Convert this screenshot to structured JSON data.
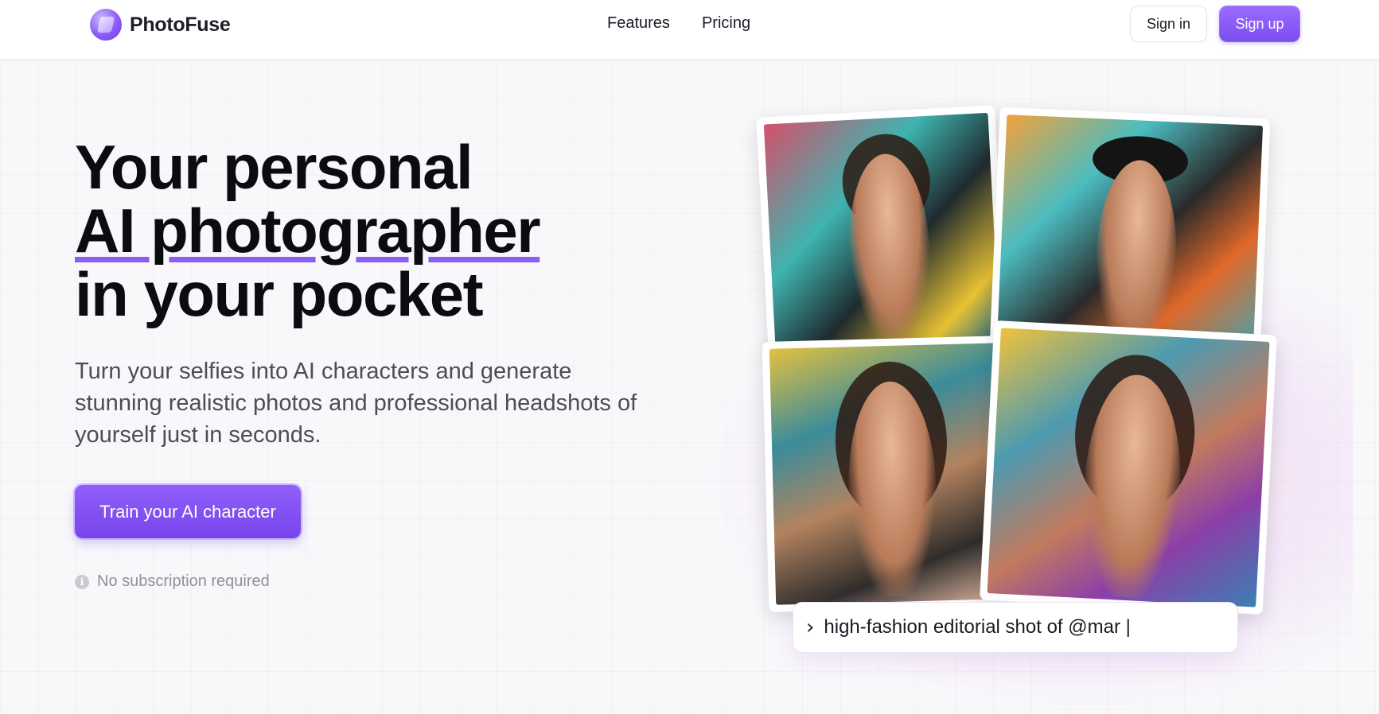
{
  "brand": {
    "name": "PhotoFuse",
    "icon": "photofuse-logo-icon"
  },
  "nav": {
    "items": [
      {
        "label": "Features"
      },
      {
        "label": "Pricing"
      }
    ]
  },
  "auth": {
    "signin_label": "Sign in",
    "signup_label": "Sign up"
  },
  "hero": {
    "headline_line1": "Your personal",
    "headline_line2": "AI photographer",
    "headline_line3": "in your pocket",
    "subtext": "Turn your selfies into AI characters and generate stunning realistic photos and professional headshots of yourself just in seconds.",
    "cta_label": "Train your AI character",
    "note": "No subscription required",
    "note_icon": "info-icon"
  },
  "prompt": {
    "icon": "chevron-right-icon",
    "text": "high-fashion editorial shot of @mar |"
  },
  "colors": {
    "accent": "#8b5cf6",
    "text": "#0b0b12",
    "muted": "#8e919c"
  }
}
